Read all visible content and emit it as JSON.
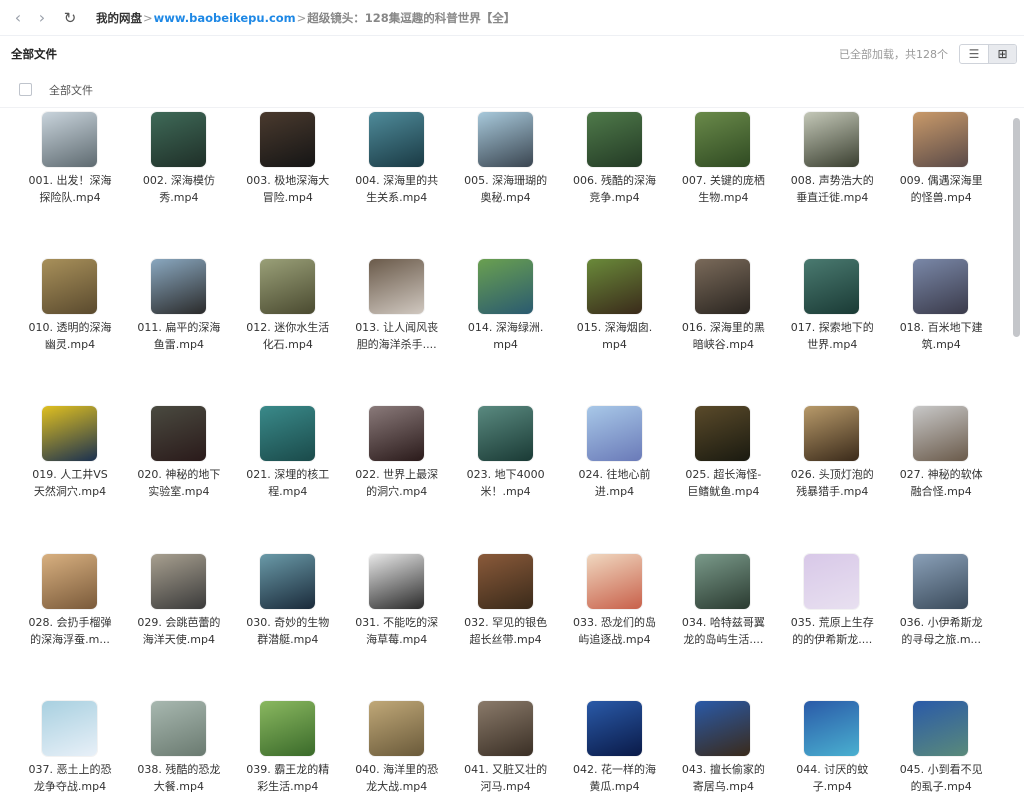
{
  "nav": {
    "back_icon": "chevron-left",
    "forward_icon": "chevron-right",
    "refresh_icon": "refresh"
  },
  "breadcrumb": {
    "home": "我的网盘",
    "separator": ">",
    "site": "www.baobeikepu.com",
    "current": "超级镜头：128集逗趣的科普世界【全】"
  },
  "toolbar": {
    "title": "全部文件",
    "status": "已全部加载，共128个",
    "view_list_icon": "list-view",
    "view_grid_icon": "grid-view",
    "active_view": "grid"
  },
  "select_all": {
    "label": "全部文件",
    "checked": false
  },
  "accent_color": "#1e88e5",
  "files": [
    {
      "label": "001. 出发！深海\n探险队.mp4",
      "colors": [
        "#c9d4dc",
        "#5e6a70"
      ]
    },
    {
      "label": "002. 深海模仿\n秀.mp4",
      "colors": [
        "#3f6a58",
        "#1f2f28"
      ]
    },
    {
      "label": "003. 极地深海大\n冒险.mp4",
      "colors": [
        "#4a3a2e",
        "#151515"
      ]
    },
    {
      "label": "004. 深海里的共\n生关系.mp4",
      "colors": [
        "#4f8b9a",
        "#1a3a44"
      ]
    },
    {
      "label": "005. 深海珊瑚的\n奥秘.mp4",
      "colors": [
        "#a8c9db",
        "#3a4550"
      ]
    },
    {
      "label": "006. 残酷的深海\n竞争.mp4",
      "colors": [
        "#4f7a4a",
        "#233a25"
      ]
    },
    {
      "label": "007. 关键的庞栖\n生物.mp4",
      "colors": [
        "#6a8a4a",
        "#2f4a22"
      ]
    },
    {
      "label": "008. 声势浩大的\n垂直迁徙.mp4",
      "colors": [
        "#c4c8b8",
        "#3a3f30"
      ]
    },
    {
      "label": "009. 偶遇深海里\n的怪兽.mp4",
      "colors": [
        "#c99a6a",
        "#5a4a48"
      ]
    },
    {
      "label": "010. 透明的深海\n幽灵.mp4",
      "colors": [
        "#a8905a",
        "#5a4a2e"
      ]
    },
    {
      "label": "011. 扁平的深海\n鱼雷.mp4",
      "colors": [
        "#8aa8c0",
        "#2a2a2a"
      ]
    },
    {
      "label": "012. 迷你水生活\n化石.mp4",
      "colors": [
        "#9aa078",
        "#4a4a30"
      ]
    },
    {
      "label": "013. 让人闻风丧\n胆的海洋杀手....",
      "colors": [
        "#6a5a4a",
        "#d0c8c0"
      ]
    },
    {
      "label": "014. 深海绿洲.\nmp4",
      "colors": [
        "#6aa050",
        "#2a5a70"
      ]
    },
    {
      "label": "015. 深海烟囱.\nmp4",
      "colors": [
        "#6a8a3a",
        "#3a2a1a"
      ]
    },
    {
      "label": "016. 深海里的黑\n暗峡谷.mp4",
      "colors": [
        "#7a6a5a",
        "#2a2520"
      ]
    },
    {
      "label": "017. 探索地下的\n世界.mp4",
      "colors": [
        "#4a7a70",
        "#1a3a35"
      ]
    },
    {
      "label": "018. 百米地下建\n筑.mp4",
      "colors": [
        "#7a88a8",
        "#3a3a4a"
      ]
    },
    {
      "label": "019. 人工井VS\n天然洞穴.mp4",
      "colors": [
        "#e0c020",
        "#1a3050"
      ]
    },
    {
      "label": "020. 神秘的地下\n实验室.mp4",
      "colors": [
        "#4a4a40",
        "#2a1a1a"
      ]
    },
    {
      "label": "021. 深埋的核工\n程.mp4",
      "colors": [
        "#3a8a8a",
        "#1a4a4a"
      ]
    },
    {
      "label": "022. 世界上最深\n的洞穴.mp4",
      "colors": [
        "#8a7a7a",
        "#2a1a1a"
      ]
    },
    {
      "label": "023. 地下4000\n米！.mp4",
      "colors": [
        "#5a8a80",
        "#1a3a35"
      ]
    },
    {
      "label": "024. 往地心前\n进.mp4",
      "colors": [
        "#a8c8e8",
        "#6a7ab8"
      ]
    },
    {
      "label": "025. 超长海怪-\n巨鳍鱿鱼.mp4",
      "colors": [
        "#5a4a2a",
        "#1a1a10"
      ]
    },
    {
      "label": "026. 头顶灯泡的\n残暴猎手.mp4",
      "colors": [
        "#b89a6a",
        "#3a2a1a"
      ]
    },
    {
      "label": "027. 神秘的软体\n融合怪.mp4",
      "colors": [
        "#c8c8c8",
        "#6a5a4a"
      ]
    },
    {
      "label": "028. 会扔手榴弹\n的深海浮蚕.m...",
      "colors": [
        "#d8b080",
        "#7a5a3a"
      ]
    },
    {
      "label": "029. 会跳芭蕾的\n海洋天使.mp4",
      "colors": [
        "#a8a090",
        "#3a3a3a"
      ]
    },
    {
      "label": "030. 奇妙的生物\n群潜艇.mp4",
      "colors": [
        "#6a9aa8",
        "#1a2a3a"
      ]
    },
    {
      "label": "031. 不能吃的深\n海草莓.mp4",
      "colors": [
        "#e8e8e8",
        "#2a2a2a"
      ]
    },
    {
      "label": "032. 罕见的银色\n超长丝带.mp4",
      "colors": [
        "#8a5a3a",
        "#3a2a1a"
      ]
    },
    {
      "label": "033. 恐龙们的岛\n屿追逐战.mp4",
      "colors": [
        "#f0d8c0",
        "#c8604a"
      ]
    },
    {
      "label": "034. 哈特兹哥翼\n龙的岛屿生活....",
      "colors": [
        "#7a9a8a",
        "#2a3a30"
      ]
    },
    {
      "label": "035. 荒原上生存\n的的伊希斯龙....",
      "colors": [
        "#d8c8e8",
        "#e8e0f0"
      ]
    },
    {
      "label": "036. 小伊希斯龙\n的寻母之旅.m...",
      "colors": [
        "#8aa0b8",
        "#3a4a5a"
      ]
    },
    {
      "label": "037. 恶土上的恐\n龙争夺战.mp4",
      "colors": [
        "#a8d0e0",
        "#e8f0f8"
      ]
    },
    {
      "label": "038. 残酷的恐龙\n大餐.mp4",
      "colors": [
        "#a8b8b0",
        "#6a7a70"
      ]
    },
    {
      "label": "039. 霸王龙的精\n彩生活.mp4",
      "colors": [
        "#8ab860",
        "#3a6a2a"
      ]
    },
    {
      "label": "040. 海洋里的恐\n龙大战.mp4",
      "colors": [
        "#c0a878",
        "#6a5a3a"
      ]
    },
    {
      "label": "041. 又脏又壮的\n河马.mp4",
      "colors": [
        "#8a7a6a",
        "#3a2f25"
      ]
    },
    {
      "label": "042. 花一样的海\n黄瓜.mp4",
      "colors": [
        "#2a5aa8",
        "#0a1a48"
      ]
    },
    {
      "label": "043. 擅长偷家的\n寄居乌.mp4",
      "colors": [
        "#2a5aa8",
        "#3a2a1a"
      ]
    },
    {
      "label": "044. 讨厌的蚊\n子.mp4",
      "colors": [
        "#2a5aa8",
        "#4ab0d0"
      ]
    },
    {
      "label": "045. 小到看不见\n的虱子.mp4",
      "colors": [
        "#2a5aa8",
        "#5a8a7a"
      ]
    }
  ]
}
